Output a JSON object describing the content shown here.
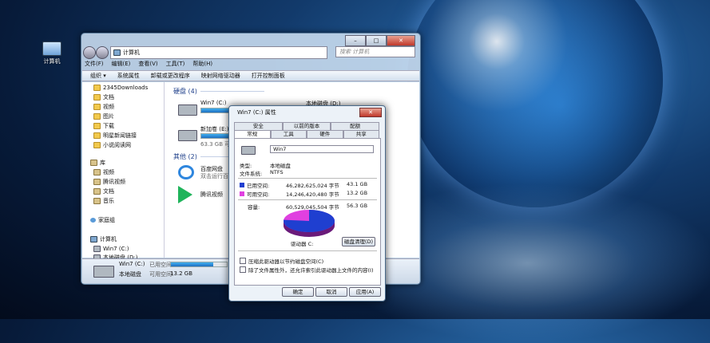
{
  "desktop": {
    "icon_label": "计算机"
  },
  "explorer": {
    "address": "计算机",
    "search_placeholder": "搜索 计算机",
    "menu": [
      "文件(F)",
      "编辑(E)",
      "查看(V)",
      "工具(T)",
      "帮助(H)"
    ],
    "toolbar": [
      "组织 ▾",
      "系统属性",
      "卸载或更改程序",
      "映射网络驱动器",
      "打开控制面板"
    ],
    "nav": {
      "favorites": [
        "2345Downloads",
        "文档",
        "视频",
        "图片",
        "下载",
        "明星新闻链接",
        "小说阅读网"
      ],
      "library_title": "库",
      "library": [
        "视频",
        "腾讯视频",
        "文档",
        "音乐"
      ],
      "homegroup": "家庭组",
      "computer": "计算机",
      "drives": [
        "Win7 (C:)",
        "本地磁盘 (D:)"
      ]
    },
    "hdd_section": "硬盘 (4)",
    "drives": [
      {
        "name": "Win7 (C:)",
        "used_fraction": 0.76
      },
      {
        "name": "新加卷 (E:)",
        "used_fraction": 0.35,
        "free_text": "63.3 GB 可用，共 97.6 GB"
      },
      {
        "name": "本地磁盘 (D:)"
      }
    ],
    "other_section": "其他 (2)",
    "others": [
      {
        "name": "百度网盘",
        "desc": "双击运行百度网盘"
      },
      {
        "name": "腾讯视频",
        "desc": ""
      }
    ],
    "status": {
      "name": "Win7 (C:)",
      "type": "本地磁盘",
      "used_label": "已用空间:",
      "free_label": "可用空间:",
      "free_value": "13.2 GB",
      "used_fraction": 0.76
    }
  },
  "props": {
    "title": "Win7 (C:) 属性",
    "close_label": "✕",
    "tabs_top": [
      "安全",
      "以前的版本",
      "配额"
    ],
    "tabs_bottom": [
      "常规",
      "工具",
      "硬件",
      "共享"
    ],
    "drive_label": "Win7",
    "type_label": "类型:",
    "type_value": "本地磁盘",
    "fs_label": "文件系统:",
    "fs_value": "NTFS",
    "used_label": "已用空间:",
    "used_bytes": "46,282,625,024 字节",
    "used_gb": "43.1 GB",
    "free_label": "可用空间:",
    "free_bytes": "14,246,420,480 字节",
    "free_gb": "13.2 GB",
    "capacity_label": "容量:",
    "capacity_bytes": "60,529,045,504 字节",
    "capacity_gb": "56.3 GB",
    "drive_name": "驱动器 C:",
    "cleanup_button": "磁盘清理(D)",
    "compress": "压缩此驱动器以节约磁盘空间(C)",
    "index": "除了文件属性外，还允许索引此驱动器上文件的内容(I)",
    "ok": "确定",
    "cancel": "取消",
    "apply": "应用(A)",
    "used_color": "#1f3fd0",
    "free_color": "#e040e0",
    "used_fraction": 0.766
  }
}
